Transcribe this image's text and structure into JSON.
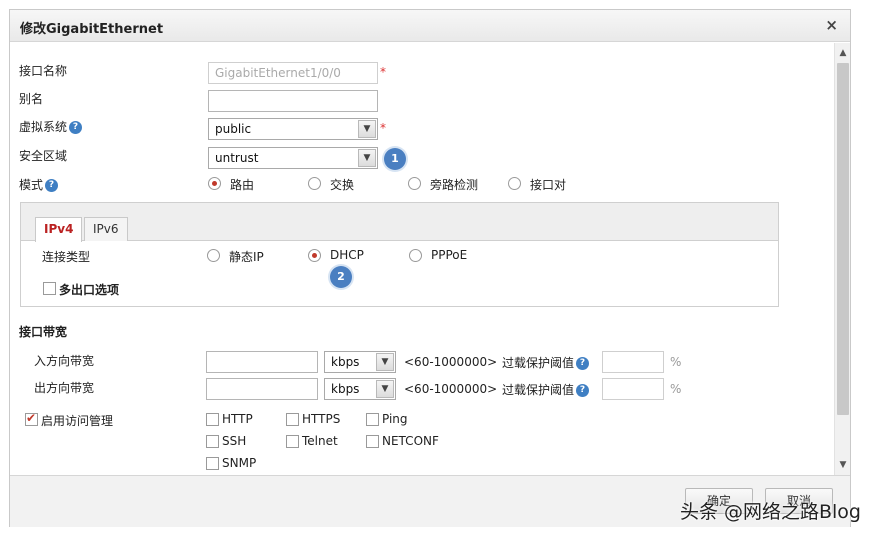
{
  "dialog": {
    "title": "修改GigabitEthernet",
    "close": "×"
  },
  "form": {
    "interface_name": {
      "label": "接口名称",
      "value": "GigabitEthernet1/0/0",
      "required": "*"
    },
    "alias": {
      "label": "别名",
      "value": ""
    },
    "virtual_system": {
      "label": "虚拟系统",
      "value": "public",
      "required": "*"
    },
    "security_zone": {
      "label": "安全区域",
      "value": "untrust"
    },
    "mode": {
      "label": "模式",
      "options": [
        "路由",
        "交换",
        "旁路检测",
        "接口对"
      ],
      "selected": "路由"
    },
    "help_icon": "?"
  },
  "tabs": {
    "ipv4": "IPv4",
    "ipv6": "IPv6",
    "active": "IPv4"
  },
  "ipv4": {
    "conn_type_label": "连接类型",
    "conn_options": [
      "静态IP",
      "DHCP",
      "PPPoE"
    ],
    "conn_selected": "DHCP",
    "multi_exit_label": "多出口选项"
  },
  "bandwidth": {
    "section_title": "接口带宽",
    "inbound_label": "入方向带宽",
    "outbound_label": "出方向带宽",
    "unit": "kbps",
    "range": "<60-1000000>",
    "overload_label": "过载保护阈值",
    "percent": "%"
  },
  "access_mgmt": {
    "label": "启用访问管理",
    "enabled": true,
    "protocols": [
      "HTTP",
      "HTTPS",
      "Ping",
      "SSH",
      "Telnet",
      "NETCONF",
      "SNMP"
    ]
  },
  "badges": {
    "one": "1",
    "two": "2"
  },
  "footer": {
    "ok": "确定",
    "cancel": "取消"
  },
  "watermark": "头条 @网络之路Blog",
  "colors": {
    "accent_red": "#c0392b",
    "help_blue": "#3f7fc3",
    "badge_blue": "#4a7fc1"
  }
}
